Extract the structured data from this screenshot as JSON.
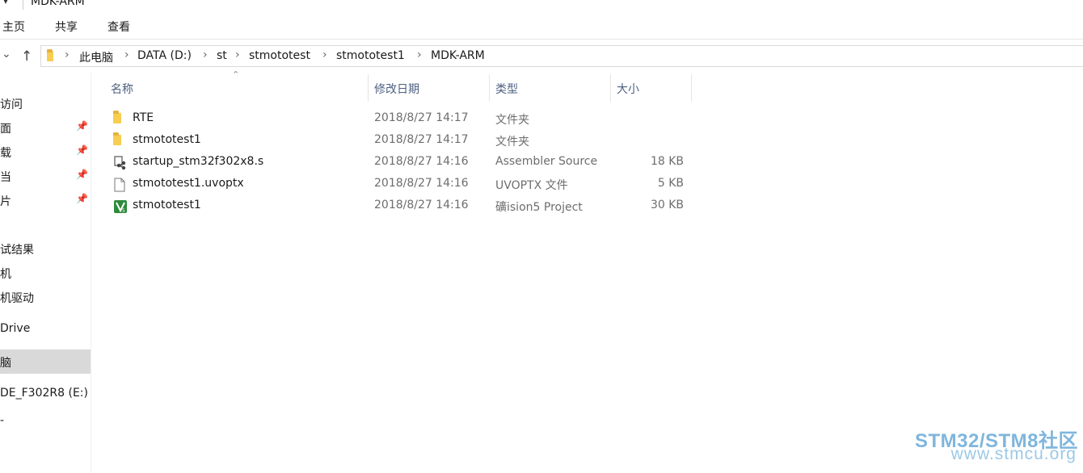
{
  "window": {
    "title": "MDK-ARM"
  },
  "ribbon": {
    "tabs": [
      "主页",
      "共享",
      "查看"
    ]
  },
  "address": {
    "crumbs": [
      "此电脑",
      "DATA (D:)",
      "st",
      "stmototest",
      "stmototest1",
      "MDK-ARM"
    ]
  },
  "sidebar": {
    "items": [
      {
        "label": "访问",
        "pinned": false
      },
      {
        "label": "面",
        "pinned": true
      },
      {
        "label": "载",
        "pinned": true
      },
      {
        "label": "当",
        "pinned": true
      },
      {
        "label": "片",
        "pinned": true
      },
      {
        "label": "试结果",
        "pinned": false
      },
      {
        "label": "机",
        "pinned": false
      },
      {
        "label": "机驱动",
        "pinned": false
      },
      {
        "label": "Drive",
        "pinned": false
      },
      {
        "label": "脑",
        "pinned": false
      },
      {
        "label": "DE_F302R8 (E:)",
        "pinned": false
      },
      {
        "label": "",
        "pinned": false
      }
    ],
    "selected_index": 9
  },
  "columns": {
    "name": "名称",
    "date": "修改日期",
    "type": "类型",
    "size": "大小"
  },
  "files": [
    {
      "name": "RTE",
      "date": "2018/8/27 14:17",
      "type": "文件夹",
      "size": "",
      "icon": "folder-icon"
    },
    {
      "name": "stmototest1",
      "date": "2018/8/27 14:17",
      "type": "文件夹",
      "size": "",
      "icon": "folder-icon"
    },
    {
      "name": "startup_stm32f302x8.s",
      "date": "2018/8/27 14:16",
      "type": "Assembler Source",
      "size": "18 KB",
      "icon": "assembler-file-icon"
    },
    {
      "name": "stmototest1.uvoptx",
      "date": "2018/8/27 14:16",
      "type": "UVOPTX 文件",
      "size": "5 KB",
      "icon": "blank-file-icon"
    },
    {
      "name": "stmototest1",
      "date": "2018/8/27 14:16",
      "type": "礦ision5 Project",
      "size": "30 KB",
      "icon": "uvision-project-icon"
    }
  ],
  "watermark": {
    "line1": "STM32/STM8社区",
    "line2": "www.stmcu.org"
  },
  "colors": {
    "folder": "#f8cd52",
    "selected_bg": "#d9d9d9",
    "header_text": "#4d6082",
    "watermark": "#7fb6dd"
  }
}
